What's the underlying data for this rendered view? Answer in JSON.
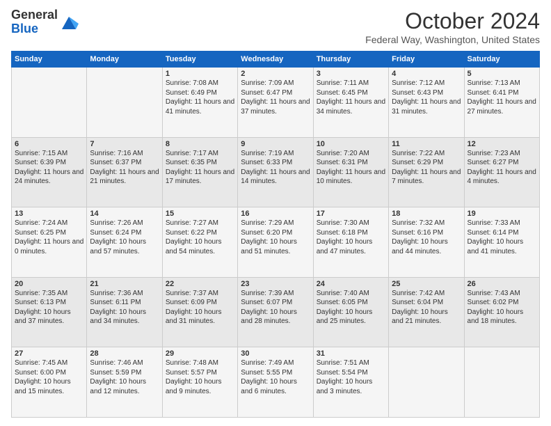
{
  "logo": {
    "general": "General",
    "blue": "Blue"
  },
  "title": "October 2024",
  "location": "Federal Way, Washington, United States",
  "days_of_week": [
    "Sunday",
    "Monday",
    "Tuesday",
    "Wednesday",
    "Thursday",
    "Friday",
    "Saturday"
  ],
  "weeks": [
    [
      {
        "day": "",
        "info": ""
      },
      {
        "day": "",
        "info": ""
      },
      {
        "day": "1",
        "info": "Sunrise: 7:08 AM\nSunset: 6:49 PM\nDaylight: 11 hours and 41 minutes."
      },
      {
        "day": "2",
        "info": "Sunrise: 7:09 AM\nSunset: 6:47 PM\nDaylight: 11 hours and 37 minutes."
      },
      {
        "day": "3",
        "info": "Sunrise: 7:11 AM\nSunset: 6:45 PM\nDaylight: 11 hours and 34 minutes."
      },
      {
        "day": "4",
        "info": "Sunrise: 7:12 AM\nSunset: 6:43 PM\nDaylight: 11 hours and 31 minutes."
      },
      {
        "day": "5",
        "info": "Sunrise: 7:13 AM\nSunset: 6:41 PM\nDaylight: 11 hours and 27 minutes."
      }
    ],
    [
      {
        "day": "6",
        "info": "Sunrise: 7:15 AM\nSunset: 6:39 PM\nDaylight: 11 hours and 24 minutes."
      },
      {
        "day": "7",
        "info": "Sunrise: 7:16 AM\nSunset: 6:37 PM\nDaylight: 11 hours and 21 minutes."
      },
      {
        "day": "8",
        "info": "Sunrise: 7:17 AM\nSunset: 6:35 PM\nDaylight: 11 hours and 17 minutes."
      },
      {
        "day": "9",
        "info": "Sunrise: 7:19 AM\nSunset: 6:33 PM\nDaylight: 11 hours and 14 minutes."
      },
      {
        "day": "10",
        "info": "Sunrise: 7:20 AM\nSunset: 6:31 PM\nDaylight: 11 hours and 10 minutes."
      },
      {
        "day": "11",
        "info": "Sunrise: 7:22 AM\nSunset: 6:29 PM\nDaylight: 11 hours and 7 minutes."
      },
      {
        "day": "12",
        "info": "Sunrise: 7:23 AM\nSunset: 6:27 PM\nDaylight: 11 hours and 4 minutes."
      }
    ],
    [
      {
        "day": "13",
        "info": "Sunrise: 7:24 AM\nSunset: 6:25 PM\nDaylight: 11 hours and 0 minutes."
      },
      {
        "day": "14",
        "info": "Sunrise: 7:26 AM\nSunset: 6:24 PM\nDaylight: 10 hours and 57 minutes."
      },
      {
        "day": "15",
        "info": "Sunrise: 7:27 AM\nSunset: 6:22 PM\nDaylight: 10 hours and 54 minutes."
      },
      {
        "day": "16",
        "info": "Sunrise: 7:29 AM\nSunset: 6:20 PM\nDaylight: 10 hours and 51 minutes."
      },
      {
        "day": "17",
        "info": "Sunrise: 7:30 AM\nSunset: 6:18 PM\nDaylight: 10 hours and 47 minutes."
      },
      {
        "day": "18",
        "info": "Sunrise: 7:32 AM\nSunset: 6:16 PM\nDaylight: 10 hours and 44 minutes."
      },
      {
        "day": "19",
        "info": "Sunrise: 7:33 AM\nSunset: 6:14 PM\nDaylight: 10 hours and 41 minutes."
      }
    ],
    [
      {
        "day": "20",
        "info": "Sunrise: 7:35 AM\nSunset: 6:13 PM\nDaylight: 10 hours and 37 minutes."
      },
      {
        "day": "21",
        "info": "Sunrise: 7:36 AM\nSunset: 6:11 PM\nDaylight: 10 hours and 34 minutes."
      },
      {
        "day": "22",
        "info": "Sunrise: 7:37 AM\nSunset: 6:09 PM\nDaylight: 10 hours and 31 minutes."
      },
      {
        "day": "23",
        "info": "Sunrise: 7:39 AM\nSunset: 6:07 PM\nDaylight: 10 hours and 28 minutes."
      },
      {
        "day": "24",
        "info": "Sunrise: 7:40 AM\nSunset: 6:05 PM\nDaylight: 10 hours and 25 minutes."
      },
      {
        "day": "25",
        "info": "Sunrise: 7:42 AM\nSunset: 6:04 PM\nDaylight: 10 hours and 21 minutes."
      },
      {
        "day": "26",
        "info": "Sunrise: 7:43 AM\nSunset: 6:02 PM\nDaylight: 10 hours and 18 minutes."
      }
    ],
    [
      {
        "day": "27",
        "info": "Sunrise: 7:45 AM\nSunset: 6:00 PM\nDaylight: 10 hours and 15 minutes."
      },
      {
        "day": "28",
        "info": "Sunrise: 7:46 AM\nSunset: 5:59 PM\nDaylight: 10 hours and 12 minutes."
      },
      {
        "day": "29",
        "info": "Sunrise: 7:48 AM\nSunset: 5:57 PM\nDaylight: 10 hours and 9 minutes."
      },
      {
        "day": "30",
        "info": "Sunrise: 7:49 AM\nSunset: 5:55 PM\nDaylight: 10 hours and 6 minutes."
      },
      {
        "day": "31",
        "info": "Sunrise: 7:51 AM\nSunset: 5:54 PM\nDaylight: 10 hours and 3 minutes."
      },
      {
        "day": "",
        "info": ""
      },
      {
        "day": "",
        "info": ""
      }
    ]
  ]
}
